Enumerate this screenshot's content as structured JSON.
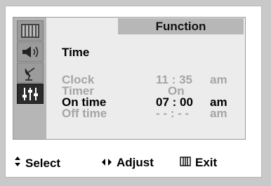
{
  "menu": {
    "title": "Function",
    "section": "Time",
    "sidebar": [
      {
        "icon": "picture-icon",
        "active": false
      },
      {
        "icon": "sound-icon",
        "active": false
      },
      {
        "icon": "satellite-dish-icon",
        "active": false
      },
      {
        "icon": "function-sliders-icon",
        "active": true
      }
    ],
    "rows": [
      {
        "label": "Clock",
        "value": "11 : 35",
        "ampm": "am",
        "selected": false
      },
      {
        "label": "Timer",
        "value": "On",
        "ampm": "",
        "selected": false
      },
      {
        "label": "On time",
        "value": "07 : 00",
        "ampm": "am",
        "selected": true
      },
      {
        "label": "Off time",
        "value": "- - : - -",
        "ampm": "am",
        "selected": false
      }
    ]
  },
  "footer": {
    "select_label": "Select",
    "adjust_label": "Adjust",
    "exit_label": "Exit"
  },
  "colors": {
    "selected_text": "#000000",
    "dim_text": "#a5a5a5",
    "sidebar": "#b6b6b6",
    "active_icon_bg": "#2b2b2b"
  }
}
